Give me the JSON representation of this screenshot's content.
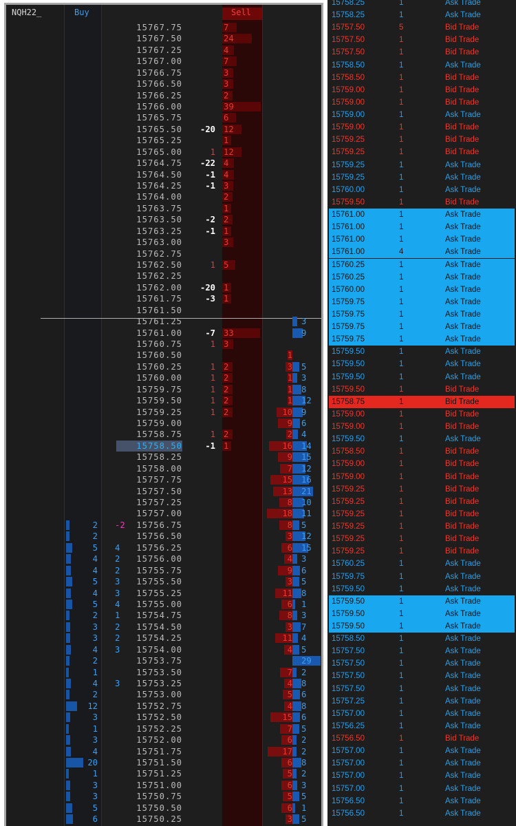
{
  "ladder": {
    "symbol": "NQH22_",
    "buy_header": "Buy",
    "sell_header": "Sell",
    "current_price": "15758.50",
    "rows": [
      {
        "price": "15767.75",
        "sell": "7"
      },
      {
        "price": "15767.50",
        "sell": "24"
      },
      {
        "price": "15767.25",
        "sell": "4"
      },
      {
        "price": "15767.00",
        "sell": "7"
      },
      {
        "price": "15766.75",
        "sell": "3"
      },
      {
        "price": "15766.50",
        "sell": "3"
      },
      {
        "price": "15766.25",
        "sell": "2"
      },
      {
        "price": "15766.00",
        "sell": "39"
      },
      {
        "price": "15765.75",
        "sell": "6"
      },
      {
        "price": "15765.50",
        "delta": "-20",
        "sell": "12"
      },
      {
        "price": "15765.25",
        "sell": "1"
      },
      {
        "price": "15765.00",
        "delta": "1",
        "sell": "12"
      },
      {
        "price": "15764.75",
        "delta": "-22",
        "sell": "4"
      },
      {
        "price": "15764.50",
        "delta": "-1",
        "sell": "4"
      },
      {
        "price": "15764.25",
        "delta": "-1",
        "sell": "3"
      },
      {
        "price": "15764.00",
        "sell": "2"
      },
      {
        "price": "15763.75",
        "sell": "1"
      },
      {
        "price": "15763.50",
        "delta": "-2",
        "sell": "2"
      },
      {
        "price": "15763.25",
        "delta": "-1",
        "sell": "1"
      },
      {
        "price": "15763.00",
        "sell": "3"
      },
      {
        "price": "15762.75"
      },
      {
        "price": "15762.50",
        "delta": "1",
        "sell": "5"
      },
      {
        "price": "15762.25"
      },
      {
        "price": "15762.00",
        "delta": "-20",
        "sell": "1"
      },
      {
        "price": "15761.75",
        "delta": "-3",
        "sell": "1"
      },
      {
        "price": "15761.50"
      },
      {
        "price": "15761.25",
        "bid_lvl": "3"
      },
      {
        "price": "15761.00",
        "delta": "-7",
        "sell": "33",
        "bid_lvl": "9"
      },
      {
        "price": "15760.75",
        "delta": "1",
        "sell": "3"
      },
      {
        "price": "15760.50",
        "ask_lvl": "1"
      },
      {
        "price": "15760.25",
        "delta": "1",
        "sell": "2",
        "ask_lvl": "3",
        "bid_lvl": "5"
      },
      {
        "price": "15760.00",
        "delta": "1",
        "sell": "2",
        "ask_lvl": "1",
        "bid_lvl": "3"
      },
      {
        "price": "15759.75",
        "delta": "1",
        "sell": "2",
        "ask_lvl": "1",
        "bid_lvl": "8"
      },
      {
        "price": "15759.50",
        "delta": "1",
        "sell": "2",
        "ask_lvl": "1",
        "bid_lvl": "12"
      },
      {
        "price": "15759.25",
        "delta": "1",
        "sell": "2",
        "ask_lvl": "10",
        "bid_lvl": "9"
      },
      {
        "price": "15759.00",
        "ask_lvl": "9",
        "bid_lvl": "6"
      },
      {
        "price": "15758.75",
        "delta": "1",
        "sell": "2",
        "ask_lvl": "2",
        "bid_lvl": "4"
      },
      {
        "price": "15758.50",
        "delta": "-1",
        "sell": "1",
        "ask_lvl": "16",
        "bid_lvl": "14"
      },
      {
        "price": "15758.25",
        "ask_lvl": "9",
        "bid_lvl": "15"
      },
      {
        "price": "15758.00",
        "ask_lvl": "7",
        "bid_lvl": "12"
      },
      {
        "price": "15757.75",
        "ask_lvl": "15",
        "bid_lvl": "16"
      },
      {
        "price": "15757.50",
        "ask_lvl": "13",
        "bid_lvl": "21"
      },
      {
        "price": "15757.25",
        "ask_lvl": "8",
        "bid_lvl": "10"
      },
      {
        "price": "15757.00",
        "ask_lvl": "18",
        "bid_lvl": "11"
      },
      {
        "price": "15756.75",
        "last_buy": "2",
        "buy_delta": "-2",
        "ask_lvl": "8",
        "bid_lvl": "5"
      },
      {
        "price": "15756.50",
        "last_buy": "2",
        "ask_lvl": "3",
        "bid_lvl": "12"
      },
      {
        "price": "15756.25",
        "last_buy": "5",
        "buy_delta": "4",
        "ask_lvl": "6",
        "bid_lvl": "15"
      },
      {
        "price": "15756.00",
        "last_buy": "4",
        "buy_delta": "2",
        "ask_lvl": "4",
        "bid_lvl": "3"
      },
      {
        "price": "15755.75",
        "last_buy": "4",
        "buy_delta": "2",
        "ask_lvl": "9",
        "bid_lvl": "6"
      },
      {
        "price": "15755.50",
        "last_buy": "5",
        "buy_delta": "3",
        "ask_lvl": "3",
        "bid_lvl": "5"
      },
      {
        "price": "15755.25",
        "last_buy": "4",
        "buy_delta": "3",
        "ask_lvl": "11",
        "bid_lvl": "8"
      },
      {
        "price": "15755.00",
        "last_buy": "5",
        "buy_delta": "4",
        "ask_lvl": "6",
        "bid_lvl": "1"
      },
      {
        "price": "15754.75",
        "last_buy": "2",
        "buy_delta": "1",
        "ask_lvl": "8",
        "bid_lvl": "3"
      },
      {
        "price": "15754.50",
        "last_buy": "3",
        "buy_delta": "2",
        "ask_lvl": "3",
        "bid_lvl": "7"
      },
      {
        "price": "15754.25",
        "last_buy": "3",
        "buy_delta": "2",
        "ask_lvl": "11",
        "bid_lvl": "4"
      },
      {
        "price": "15754.00",
        "last_buy": "4",
        "buy_delta": "3",
        "ask_lvl": "4",
        "bid_lvl": "5"
      },
      {
        "price": "15753.75",
        "last_buy": "2",
        "bid_lvl": "29"
      },
      {
        "price": "15753.50",
        "last_buy": "1",
        "ask_lvl": "7",
        "bid_lvl": "2"
      },
      {
        "price": "15753.25",
        "last_buy": "4",
        "buy_delta": "3",
        "ask_lvl": "4",
        "bid_lvl": "8"
      },
      {
        "price": "15753.00",
        "last_buy": "2",
        "ask_lvl": "5",
        "bid_lvl": "6"
      },
      {
        "price": "15752.75",
        "last_buy": "12",
        "ask_lvl": "4",
        "bid_lvl": "8"
      },
      {
        "price": "15752.50",
        "last_buy": "3",
        "ask_lvl": "15",
        "bid_lvl": "6"
      },
      {
        "price": "15752.25",
        "last_buy": "1",
        "ask_lvl": "7",
        "bid_lvl": "5"
      },
      {
        "price": "15752.00",
        "last_buy": "3",
        "ask_lvl": "6",
        "bid_lvl": "2"
      },
      {
        "price": "15751.75",
        "last_buy": "4",
        "ask_lvl": "17",
        "bid_lvl": "2"
      },
      {
        "price": "15751.50",
        "last_buy": "20",
        "ask_lvl": "6",
        "bid_lvl": "8"
      },
      {
        "price": "15751.25",
        "last_buy": "1",
        "ask_lvl": "5",
        "bid_lvl": "2"
      },
      {
        "price": "15751.00",
        "last_buy": "3",
        "ask_lvl": "6",
        "bid_lvl": "3"
      },
      {
        "price": "15750.75",
        "last_buy": "3",
        "ask_lvl": "5",
        "bid_lvl": "5"
      },
      {
        "price": "15750.50",
        "last_buy": "5",
        "ask_lvl": "6",
        "bid_lvl": "1"
      },
      {
        "price": "15750.25",
        "last_buy": "6",
        "ask_lvl": "3",
        "bid_lvl": "5"
      }
    ]
  },
  "tape": {
    "rows": [
      {
        "price": "15758.25",
        "qty": "1",
        "type": "Ask Trade",
        "hl": ""
      },
      {
        "price": "15758.25",
        "qty": "1",
        "type": "Ask Trade",
        "hl": ""
      },
      {
        "price": "15757.50",
        "qty": "5",
        "type": "Bid Trade",
        "hl": ""
      },
      {
        "price": "15757.50",
        "qty": "1",
        "type": "Bid Trade",
        "hl": ""
      },
      {
        "price": "15757.50",
        "qty": "1",
        "type": "Bid Trade",
        "hl": ""
      },
      {
        "price": "15758.50",
        "qty": "1",
        "type": "Ask Trade",
        "hl": ""
      },
      {
        "price": "15758.50",
        "qty": "1",
        "type": "Bid Trade",
        "hl": ""
      },
      {
        "price": "15759.00",
        "qty": "1",
        "type": "Bid Trade",
        "hl": ""
      },
      {
        "price": "15759.00",
        "qty": "1",
        "type": "Bid Trade",
        "hl": ""
      },
      {
        "price": "15759.00",
        "qty": "1",
        "type": "Ask Trade",
        "hl": ""
      },
      {
        "price": "15759.00",
        "qty": "1",
        "type": "Bid Trade",
        "hl": ""
      },
      {
        "price": "15759.25",
        "qty": "1",
        "type": "Bid Trade",
        "hl": ""
      },
      {
        "price": "15759.25",
        "qty": "1",
        "type": "Bid Trade",
        "hl": ""
      },
      {
        "price": "15759.25",
        "qty": "1",
        "type": "Ask Trade",
        "hl": ""
      },
      {
        "price": "15759.25",
        "qty": "1",
        "type": "Ask Trade",
        "hl": ""
      },
      {
        "price": "15760.00",
        "qty": "1",
        "type": "Ask Trade",
        "hl": ""
      },
      {
        "price": "15759.50",
        "qty": "1",
        "type": "Bid Trade",
        "hl": ""
      },
      {
        "price": "15761.00",
        "qty": "1",
        "type": "Ask Trade",
        "hl": "blue"
      },
      {
        "price": "15761.00",
        "qty": "1",
        "type": "Ask Trade",
        "hl": "blue"
      },
      {
        "price": "15761.00",
        "qty": "1",
        "type": "Ask Trade",
        "hl": "blue"
      },
      {
        "price": "15761.00",
        "qty": "4",
        "type": "Ask Trade",
        "hl": "blue"
      },
      {
        "price": "15760.25",
        "qty": "1",
        "type": "Ask Trade",
        "hl": "blue"
      },
      {
        "price": "15760.25",
        "qty": "1",
        "type": "Ask Trade",
        "hl": "blue"
      },
      {
        "price": "15760.00",
        "qty": "1",
        "type": "Ask Trade",
        "hl": "blue"
      },
      {
        "price": "15759.75",
        "qty": "1",
        "type": "Ask Trade",
        "hl": "blue"
      },
      {
        "price": "15759.75",
        "qty": "1",
        "type": "Ask Trade",
        "hl": "blue"
      },
      {
        "price": "15759.75",
        "qty": "1",
        "type": "Ask Trade",
        "hl": "blue"
      },
      {
        "price": "15759.75",
        "qty": "1",
        "type": "Ask Trade",
        "hl": "blue"
      },
      {
        "price": "15759.50",
        "qty": "1",
        "type": "Ask Trade",
        "hl": ""
      },
      {
        "price": "15759.50",
        "qty": "1",
        "type": "Ask Trade",
        "hl": ""
      },
      {
        "price": "15759.50",
        "qty": "1",
        "type": "Ask Trade",
        "hl": ""
      },
      {
        "price": "15759.50",
        "qty": "1",
        "type": "Bid Trade",
        "hl": ""
      },
      {
        "price": "15758.75",
        "qty": "1",
        "type": "Bid Trade",
        "hl": "red"
      },
      {
        "price": "15759.00",
        "qty": "1",
        "type": "Bid Trade",
        "hl": ""
      },
      {
        "price": "15759.00",
        "qty": "1",
        "type": "Bid Trade",
        "hl": ""
      },
      {
        "price": "15759.50",
        "qty": "1",
        "type": "Ask Trade",
        "hl": ""
      },
      {
        "price": "15758.50",
        "qty": "1",
        "type": "Bid Trade",
        "hl": ""
      },
      {
        "price": "15759.00",
        "qty": "1",
        "type": "Bid Trade",
        "hl": ""
      },
      {
        "price": "15759.00",
        "qty": "1",
        "type": "Bid Trade",
        "hl": ""
      },
      {
        "price": "15759.25",
        "qty": "1",
        "type": "Bid Trade",
        "hl": ""
      },
      {
        "price": "15759.25",
        "qty": "1",
        "type": "Bid Trade",
        "hl": ""
      },
      {
        "price": "15759.25",
        "qty": "1",
        "type": "Bid Trade",
        "hl": ""
      },
      {
        "price": "15759.25",
        "qty": "1",
        "type": "Bid Trade",
        "hl": ""
      },
      {
        "price": "15759.25",
        "qty": "1",
        "type": "Bid Trade",
        "hl": ""
      },
      {
        "price": "15759.25",
        "qty": "1",
        "type": "Bid Trade",
        "hl": ""
      },
      {
        "price": "15760.25",
        "qty": "1",
        "type": "Ask Trade",
        "hl": ""
      },
      {
        "price": "15759.75",
        "qty": "1",
        "type": "Ask Trade",
        "hl": ""
      },
      {
        "price": "15759.50",
        "qty": "1",
        "type": "Ask Trade",
        "hl": ""
      },
      {
        "price": "15759.50",
        "qty": "1",
        "type": "Ask Trade",
        "hl": "blue"
      },
      {
        "price": "15759.50",
        "qty": "1",
        "type": "Ask Trade",
        "hl": "blue"
      },
      {
        "price": "15759.50",
        "qty": "1",
        "type": "Ask Trade",
        "hl": "blue"
      },
      {
        "price": "15758.50",
        "qty": "1",
        "type": "Ask Trade",
        "hl": ""
      },
      {
        "price": "15757.50",
        "qty": "1",
        "type": "Ask Trade",
        "hl": ""
      },
      {
        "price": "15757.50",
        "qty": "1",
        "type": "Ask Trade",
        "hl": ""
      },
      {
        "price": "15757.50",
        "qty": "1",
        "type": "Ask Trade",
        "hl": ""
      },
      {
        "price": "15757.50",
        "qty": "1",
        "type": "Ask Trade",
        "hl": ""
      },
      {
        "price": "15757.25",
        "qty": "1",
        "type": "Ask Trade",
        "hl": ""
      },
      {
        "price": "15757.00",
        "qty": "1",
        "type": "Ask Trade",
        "hl": ""
      },
      {
        "price": "15756.25",
        "qty": "1",
        "type": "Ask Trade",
        "hl": ""
      },
      {
        "price": "15756.50",
        "qty": "1",
        "type": "Bid Trade",
        "hl": ""
      },
      {
        "price": "15757.00",
        "qty": "1",
        "type": "Ask Trade",
        "hl": ""
      },
      {
        "price": "15757.00",
        "qty": "1",
        "type": "Ask Trade",
        "hl": ""
      },
      {
        "price": "15757.00",
        "qty": "1",
        "type": "Ask Trade",
        "hl": ""
      },
      {
        "price": "15757.00",
        "qty": "1",
        "type": "Ask Trade",
        "hl": ""
      },
      {
        "price": "15756.50",
        "qty": "1",
        "type": "Ask Trade",
        "hl": ""
      },
      {
        "price": "15756.50",
        "qty": "1",
        "type": "Ask Trade",
        "hl": ""
      }
    ]
  },
  "colors": {
    "ask": "#2a9fe8",
    "bid": "#e8392e",
    "highlight_blue": "#19a7ef",
    "highlight_red": "#e5281f",
    "panel_bg": "#1e1e1e"
  }
}
